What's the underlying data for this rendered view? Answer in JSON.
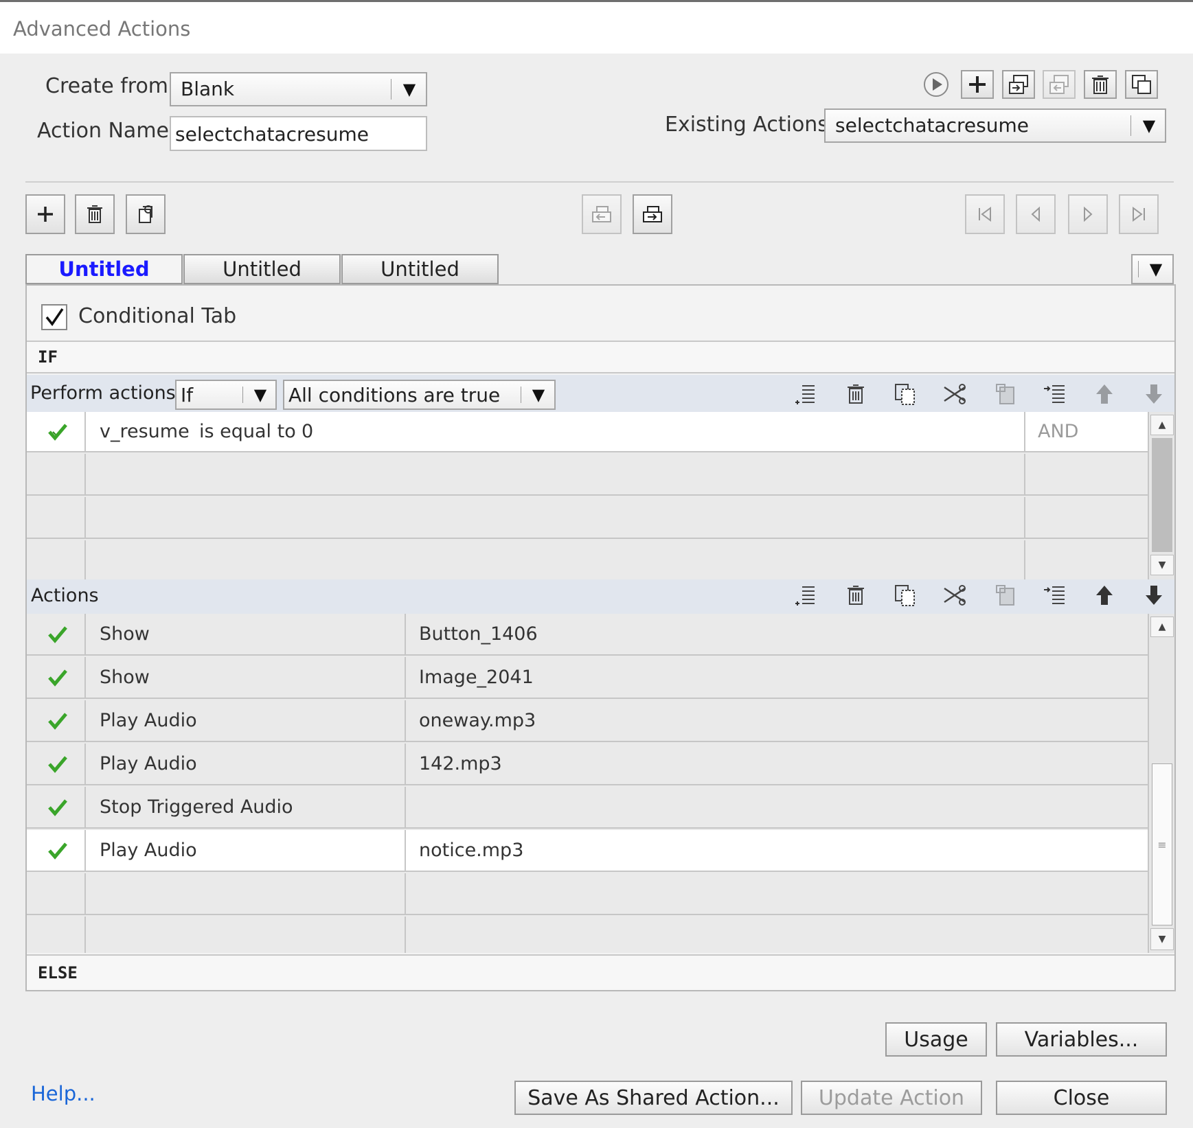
{
  "window": {
    "title": "Advanced Actions"
  },
  "form": {
    "create_from_label": "Create from:",
    "create_from_value": "Blank",
    "action_name_label": "Action Name:",
    "action_name_value": "selectchatacresume",
    "existing_actions_label": "Existing Actions:",
    "existing_actions_value": "selectchatacresume"
  },
  "tabs": [
    {
      "label": "Untitled",
      "active": true
    },
    {
      "label": "Untitled",
      "active": false
    },
    {
      "label": "Untitled",
      "active": false
    }
  ],
  "conditional_tab": {
    "label": "Conditional Tab",
    "checked": true
  },
  "if_section": {
    "header": "IF",
    "perform_label": "Perform actions:",
    "perform_value": "If",
    "conditions_value": "All conditions are true",
    "conditions": [
      {
        "variable": "v_resume",
        "operator": "is equal to",
        "value": "0",
        "join": "AND"
      }
    ]
  },
  "actions_section": {
    "header": "Actions",
    "rows": [
      {
        "action": "Show",
        "target": "Button_1406"
      },
      {
        "action": "Show",
        "target": "Image_2041"
      },
      {
        "action": "Play Audio",
        "target": "oneway.mp3"
      },
      {
        "action": "Play Audio",
        "target": "142.mp3"
      },
      {
        "action": "Stop Triggered Audio",
        "target": ""
      },
      {
        "action": "Play Audio",
        "target": "notice.mp3"
      }
    ]
  },
  "else_section": {
    "header": "ELSE"
  },
  "buttons": {
    "usage": "Usage",
    "variables": "Variables...",
    "save_shared": "Save As Shared Action...",
    "update": "Update Action",
    "close": "Close",
    "help": "Help..."
  },
  "colors": {
    "accent_tab": "#1a1aff",
    "check_green": "#3aa52a",
    "link": "#1a66d8"
  }
}
